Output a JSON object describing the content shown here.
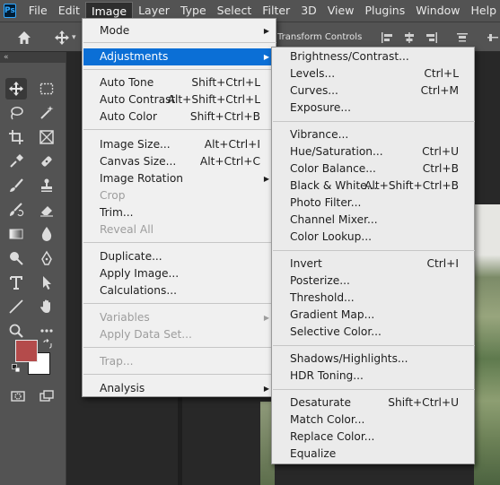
{
  "menubar": {
    "logo": "Ps",
    "items": [
      "File",
      "Edit",
      "Image",
      "Layer",
      "Type",
      "Select",
      "Filter",
      "3D",
      "View",
      "Plugins",
      "Window",
      "Help"
    ],
    "active": "Image"
  },
  "options_bar": {
    "transform_controls": "Transform Controls"
  },
  "colors": {
    "foreground": "#b44b4b",
    "background": "#ffffff",
    "menu_highlight": "#0b6fd6"
  },
  "image_menu": {
    "items": [
      {
        "label": "Mode",
        "shortcut": "",
        "submenu": true,
        "disabled": false
      },
      {
        "label": "Adjustments",
        "shortcut": "",
        "submenu": true,
        "disabled": false,
        "highlighted": true
      },
      {
        "label": "Auto Tone",
        "shortcut": "Shift+Ctrl+L",
        "disabled": false
      },
      {
        "label": "Auto Contrast",
        "shortcut": "Alt+Shift+Ctrl+L",
        "disabled": false
      },
      {
        "label": "Auto Color",
        "shortcut": "Shift+Ctrl+B",
        "disabled": false
      },
      {
        "label": "Image Size...",
        "shortcut": "Alt+Ctrl+I",
        "disabled": false
      },
      {
        "label": "Canvas Size...",
        "shortcut": "Alt+Ctrl+C",
        "disabled": false
      },
      {
        "label": "Image Rotation",
        "shortcut": "",
        "submenu": true,
        "disabled": false
      },
      {
        "label": "Crop",
        "shortcut": "",
        "disabled": true
      },
      {
        "label": "Trim...",
        "shortcut": "",
        "disabled": false
      },
      {
        "label": "Reveal All",
        "shortcut": "",
        "disabled": true
      },
      {
        "label": "Duplicate...",
        "shortcut": "",
        "disabled": false
      },
      {
        "label": "Apply Image...",
        "shortcut": "",
        "disabled": false
      },
      {
        "label": "Calculations...",
        "shortcut": "",
        "disabled": false
      },
      {
        "label": "Variables",
        "shortcut": "",
        "submenu": true,
        "disabled": true
      },
      {
        "label": "Apply Data Set...",
        "shortcut": "",
        "disabled": true
      },
      {
        "label": "Trap...",
        "shortcut": "",
        "disabled": true
      },
      {
        "label": "Analysis",
        "shortcut": "",
        "submenu": true,
        "disabled": false
      }
    ]
  },
  "adjustments_menu": {
    "items": [
      {
        "label": "Brightness/Contrast...",
        "shortcut": ""
      },
      {
        "label": "Levels...",
        "shortcut": "Ctrl+L"
      },
      {
        "label": "Curves...",
        "shortcut": "Ctrl+M"
      },
      {
        "label": "Exposure...",
        "shortcut": ""
      },
      {
        "label": "Vibrance...",
        "shortcut": ""
      },
      {
        "label": "Hue/Saturation...",
        "shortcut": "Ctrl+U"
      },
      {
        "label": "Color Balance...",
        "shortcut": "Ctrl+B"
      },
      {
        "label": "Black & White...",
        "shortcut": "Alt+Shift+Ctrl+B"
      },
      {
        "label": "Photo Filter...",
        "shortcut": ""
      },
      {
        "label": "Channel Mixer...",
        "shortcut": ""
      },
      {
        "label": "Color Lookup...",
        "shortcut": ""
      },
      {
        "label": "Invert",
        "shortcut": "Ctrl+I"
      },
      {
        "label": "Posterize...",
        "shortcut": ""
      },
      {
        "label": "Threshold...",
        "shortcut": ""
      },
      {
        "label": "Gradient Map...",
        "shortcut": ""
      },
      {
        "label": "Selective Color...",
        "shortcut": ""
      },
      {
        "label": "Shadows/Highlights...",
        "shortcut": ""
      },
      {
        "label": "HDR Toning...",
        "shortcut": ""
      },
      {
        "label": "Desaturate",
        "shortcut": "Shift+Ctrl+U"
      },
      {
        "label": "Match Color...",
        "shortcut": ""
      },
      {
        "label": "Replace Color...",
        "shortcut": ""
      },
      {
        "label": "Equalize",
        "shortcut": ""
      }
    ]
  }
}
